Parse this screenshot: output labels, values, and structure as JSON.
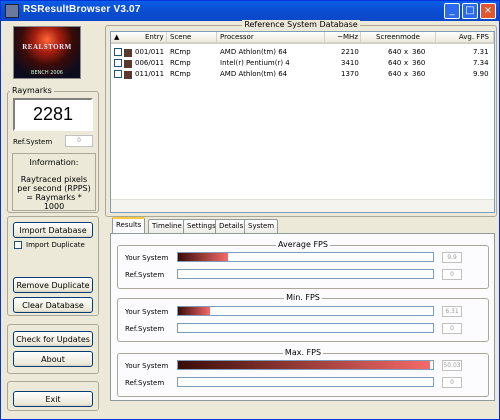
{
  "window": {
    "title": "RSResultBrowser V3.07",
    "controls": [
      "_",
      "□",
      "×"
    ]
  },
  "logo": {
    "name": "REALSTORM",
    "sub": "BENCH 2006"
  },
  "raymarks": {
    "label": "Raymarks",
    "value": "2281",
    "ref_label": "Ref.System",
    "ref_value": "0"
  },
  "information": {
    "label": "Information:",
    "text": "Raytraced pixels per second (RPPS) = Raymarks * 1000"
  },
  "buttons": {
    "import_database": "Import Database",
    "import_duplicate": "Import Duplicate",
    "remove_duplicate": "Remove Duplicate",
    "clear_database": "Clear Database",
    "check_updates": "Check for Updates",
    "about": "About",
    "exit": "Exit"
  },
  "database": {
    "title": "Reference System Database",
    "columns": [
      "Entry",
      "Scene",
      "Processor",
      "~MHz",
      "Screenmode",
      "Avg. FPS"
    ],
    "rows": [
      {
        "entry": "001/011",
        "scene": "RCmp",
        "processor": "AMD Athlon(tm) 64",
        "mhz": "2210",
        "w": "640",
        "x": "x",
        "h": "360",
        "fps": "7.31"
      },
      {
        "entry": "006/011",
        "scene": "RCmp",
        "processor": "Intel(r) Pentium(r) 4",
        "mhz": "3410",
        "w": "640",
        "x": "x",
        "h": "360",
        "fps": "7.34"
      },
      {
        "entry": "011/011",
        "scene": "RCmp",
        "processor": "AMD Athlon(tm) 64",
        "mhz": "1370",
        "w": "640",
        "x": "x",
        "h": "360",
        "fps": "9.90"
      }
    ]
  },
  "tabs": [
    "Results",
    "Timeline",
    "Settings",
    "Details",
    "System"
  ],
  "results": {
    "your_system_label": "Your System",
    "ref_system_label": "Ref.System",
    "groups": [
      {
        "title": "Average FPS",
        "your_value": "9.9",
        "your_fraction": 0.195,
        "ref_value": "0",
        "ref_fraction": 0
      },
      {
        "title": "Min. FPS",
        "your_value": "6.31",
        "your_fraction": 0.125,
        "ref_value": "0",
        "ref_fraction": 0
      },
      {
        "title": "Max. FPS",
        "your_value": "50.03",
        "your_fraction": 0.99,
        "ref_value": "0",
        "ref_fraction": 0
      }
    ]
  },
  "colors": {
    "bar_start": "#3a0d08",
    "bar_end": "#f56a6a"
  }
}
